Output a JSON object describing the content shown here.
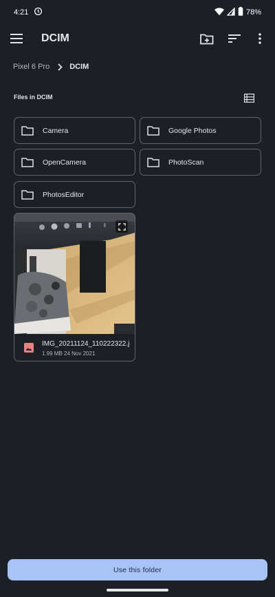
{
  "status_bar": {
    "time": "4:21",
    "battery": "78%"
  },
  "app_bar": {
    "title": "DCIM",
    "icons": [
      "menu-icon",
      "new-folder-icon",
      "sort-icon",
      "more-vert-icon"
    ]
  },
  "breadcrumb": {
    "root": "Pixel 6 Pro",
    "current": "DCIM"
  },
  "section": {
    "label": "Files in DCIM"
  },
  "folders": [
    {
      "name": "Camera"
    },
    {
      "name": "Google Photos"
    },
    {
      "name": "OpenCamera"
    },
    {
      "name": "PhotoScan"
    },
    {
      "name": "PhotosEditor"
    }
  ],
  "files": [
    {
      "name": "IMG_20211124_110222322.j...",
      "size": "1.99 MB",
      "date": "24 Nov 2021"
    }
  ],
  "bottom": {
    "button_label": "Use this folder"
  },
  "colors": {
    "background": "#1c2026",
    "outline": "#5f6671",
    "primary_button": "#a8c3f5",
    "image_icon": "#e8837f"
  }
}
